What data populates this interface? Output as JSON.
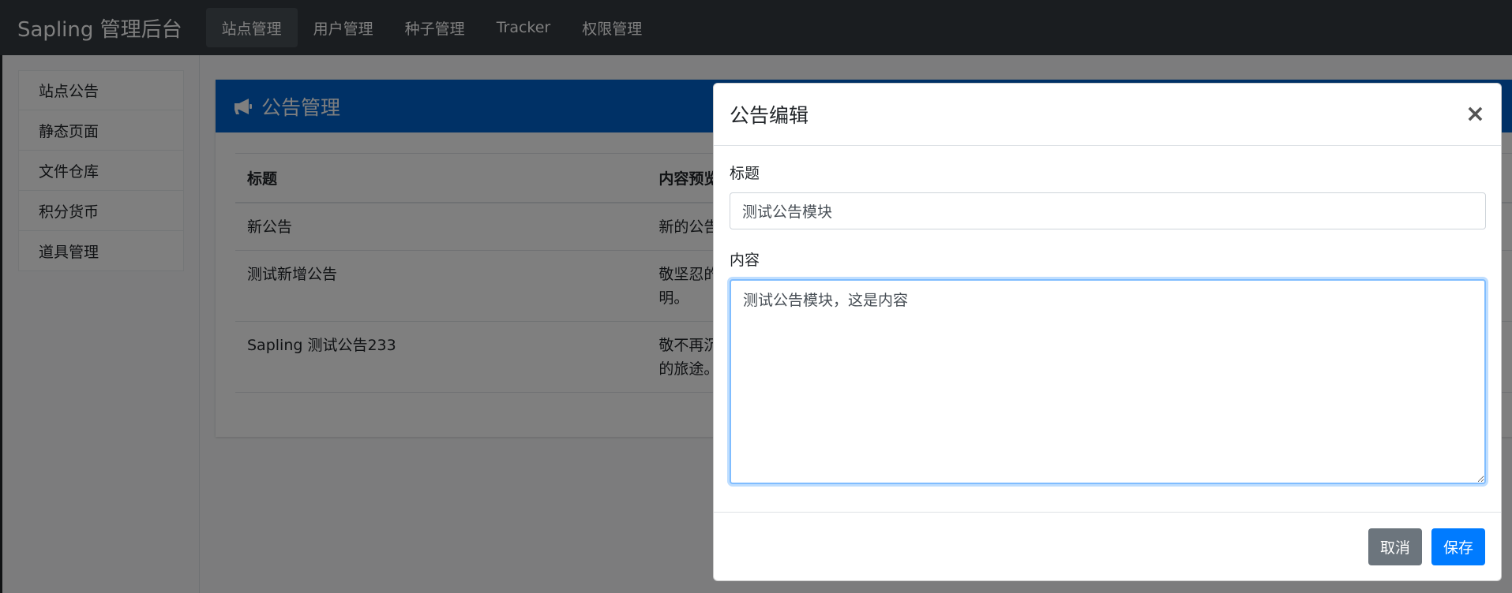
{
  "app": {
    "brand": "Sapling 管理后台"
  },
  "nav": {
    "items": [
      {
        "label": "站点管理",
        "active": true
      },
      {
        "label": "用户管理",
        "active": false
      },
      {
        "label": "种子管理",
        "active": false
      },
      {
        "label": "Tracker",
        "active": false
      },
      {
        "label": "权限管理",
        "active": false
      }
    ]
  },
  "sidebar": {
    "items": [
      {
        "label": "站点公告"
      },
      {
        "label": "静态页面"
      },
      {
        "label": "文件仓库"
      },
      {
        "label": "积分货币"
      },
      {
        "label": "道具管理"
      }
    ]
  },
  "card": {
    "icon": "megaphone-icon",
    "title": "公告管理",
    "columns": [
      "标题",
      "内容预览"
    ],
    "rows": [
      {
        "title": "新公告",
        "preview": "新的公告"
      },
      {
        "title": "测试新增公告",
        "preview": "敬坚忍的",
        "preview2": "明。"
      },
      {
        "title": "Sapling 测试公告233",
        "preview": "敬不再沉",
        "preview2": "的旅途。"
      }
    ]
  },
  "modal": {
    "title": "公告编辑",
    "close": "×",
    "title_label": "标题",
    "title_value": "测试公告模块",
    "content_label": "内容",
    "content_value": "测试公告模块，这是内容",
    "cancel_label": "取消",
    "save_label": "保存"
  },
  "colors": {
    "navbar": "#343a40",
    "card_header": "#0062cc",
    "primary": "#007bff",
    "secondary": "#6c757d"
  }
}
